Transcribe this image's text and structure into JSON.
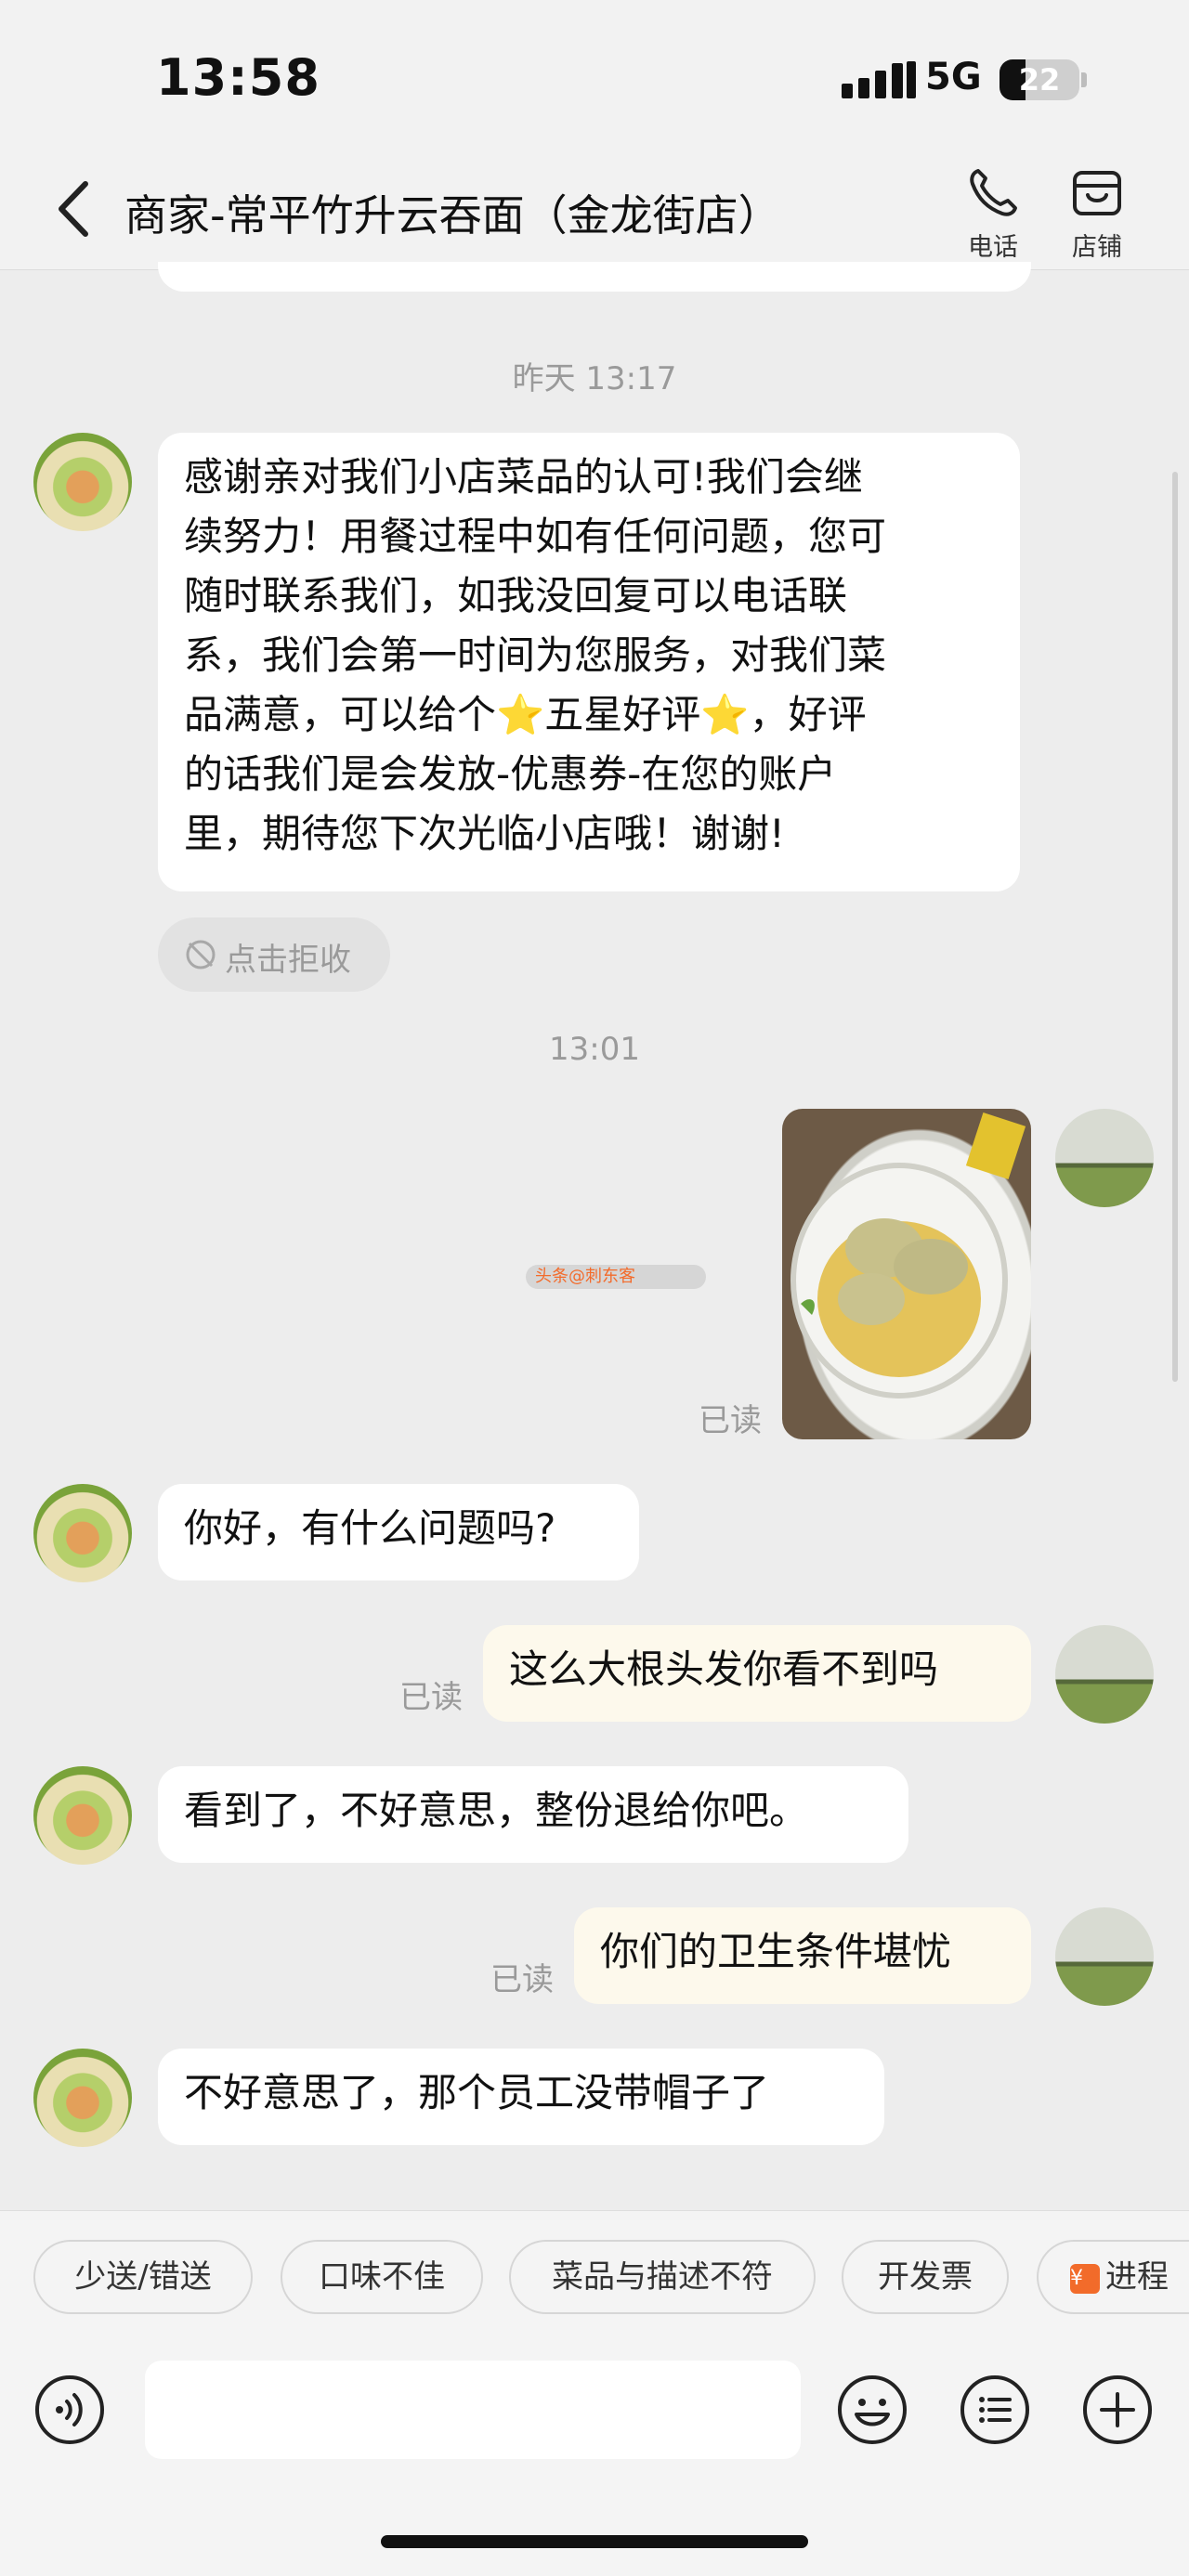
{
  "status_bar": {
    "time": "13:58",
    "network": "5G",
    "battery": "22"
  },
  "nav": {
    "back_label": "",
    "title": "商家-常平竹升云吞面（金龙街店）",
    "phone_label": "电话",
    "store_label": "店铺"
  },
  "messages": {
    "ts1": "昨天 13:17",
    "merchant_long": [
      "感谢亲对我们小店菜品的认可!我们会继",
      "续努力！用餐过程中如有任何问题，您可",
      "随时联系我们，如我没回复可以电话联",
      "系，我们会第一时间为您服务，对我们菜",
      "品满意，可以给个⭐五星好评⭐，好评",
      "的话我们是会发放-优惠券-在您的账户",
      "里，期待您下次光临小店哦！谢谢!"
    ],
    "reject": "点击拒收",
    "ts2": "13:01",
    "read": "已读",
    "watermark": "头条@刺东客",
    "m2": "你好，有什么问题吗?",
    "u2": "这么大根头发你看不到吗",
    "m3": "看到了，不好意思，整份退给你吧。",
    "u3": "你们的卫生条件堪忧",
    "m4": "不好意思了，那个员工没带帽子了"
  },
  "quick_replies": [
    "少送/错送",
    "口味不佳",
    "菜品与描述不符",
    "开发票",
    "进程"
  ],
  "quick_tag": "¥",
  "icons": [
    "back-icon",
    "phone-icon",
    "store-icon",
    "voice-icon",
    "emoji-icon",
    "list-icon",
    "plus-icon"
  ]
}
